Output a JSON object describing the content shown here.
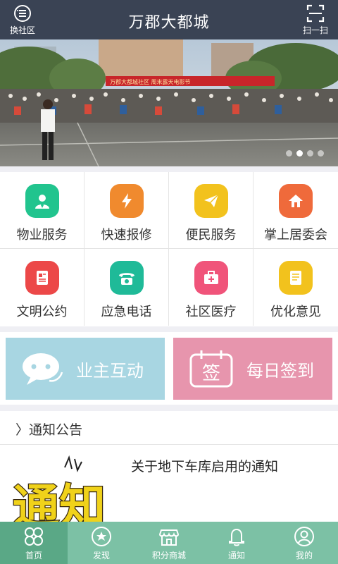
{
  "header": {
    "title": "万郡大都城",
    "switch_label": "换社区",
    "scan_label": "扫一扫"
  },
  "banner": {
    "sign_text": "万郡大都城社区    周末露天电影节",
    "slide_count": 4,
    "active_slide": 2
  },
  "services": [
    {
      "label": "物业服务",
      "icon": "person-icon",
      "color": "#21c48e"
    },
    {
      "label": "快速报修",
      "icon": "lightning-icon",
      "color": "#f08a2e"
    },
    {
      "label": "便民服务",
      "icon": "paper-plane-icon",
      "color": "#f2c21d"
    },
    {
      "label": "掌上居委会",
      "icon": "home-icon",
      "color": "#ef6a3b"
    },
    {
      "label": "文明公约",
      "icon": "document-icon",
      "color": "#ec4848"
    },
    {
      "label": "应急电话",
      "icon": "telephone-icon",
      "color": "#1fba98"
    },
    {
      "label": "社区医疗",
      "icon": "medical-kit-icon",
      "color": "#f0547a"
    },
    {
      "label": "优化意见",
      "icon": "notepad-icon",
      "color": "#f2c21d"
    }
  ],
  "big_buttons": {
    "interaction_label": "业主互动",
    "signin_label": "每日签到",
    "signin_icon_text": "签"
  },
  "notice": {
    "section_title": "〉通知公告",
    "items": [
      {
        "title": "关于地下车库启用的通知",
        "thumb_text": "通知"
      }
    ]
  },
  "tabs": [
    {
      "label": "首页",
      "icon": "clover-icon",
      "active": true
    },
    {
      "label": "发现",
      "icon": "compass-icon",
      "active": false
    },
    {
      "label": "积分商城",
      "icon": "store-icon",
      "active": false
    },
    {
      "label": "通知",
      "icon": "bell-icon",
      "active": false
    },
    {
      "label": "我的",
      "icon": "user-icon",
      "active": false
    }
  ]
}
